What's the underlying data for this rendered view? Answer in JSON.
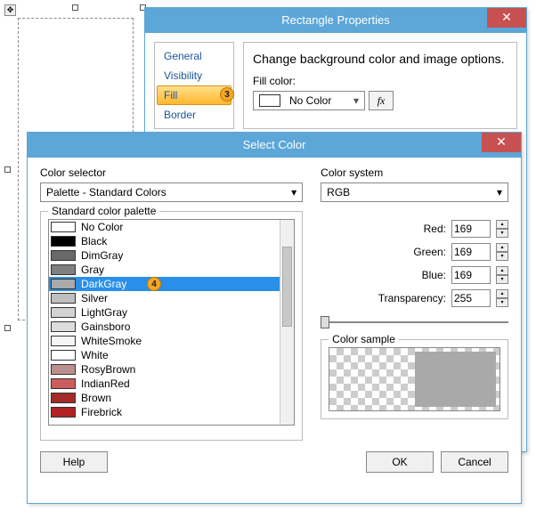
{
  "rect_dialog": {
    "title": "Rectangle Properties",
    "nav": [
      "General",
      "Visibility",
      "Fill",
      "Border"
    ],
    "nav_selected_index": 2,
    "description": "Change background color and image options.",
    "fill_color_label": "Fill color:",
    "fill_color_selected": "No Color",
    "fx_label": "fx",
    "badge_3": "3"
  },
  "select_dialog": {
    "title": "Select Color",
    "selector_label": "Color selector",
    "selector_value": "Palette - Standard Colors",
    "system_label": "Color system",
    "system_value": "RGB",
    "palette_legend": "Standard color palette",
    "colors": [
      {
        "name": "No Color",
        "hex": "#ffffff"
      },
      {
        "name": "Black",
        "hex": "#000000"
      },
      {
        "name": "DimGray",
        "hex": "#696969"
      },
      {
        "name": "Gray",
        "hex": "#808080"
      },
      {
        "name": "DarkGray",
        "hex": "#a9a9a9"
      },
      {
        "name": "Silver",
        "hex": "#c0c0c0"
      },
      {
        "name": "LightGray",
        "hex": "#d3d3d3"
      },
      {
        "name": "Gainsboro",
        "hex": "#dcdcdc"
      },
      {
        "name": "WhiteSmoke",
        "hex": "#f5f5f5"
      },
      {
        "name": "White",
        "hex": "#ffffff"
      },
      {
        "name": "RosyBrown",
        "hex": "#bc8f8f"
      },
      {
        "name": "IndianRed",
        "hex": "#cd5c5c"
      },
      {
        "name": "Brown",
        "hex": "#a52a2a"
      },
      {
        "name": "Firebrick",
        "hex": "#b22222"
      }
    ],
    "selected_color_index": 4,
    "badge_4": "4",
    "rgb_labels": {
      "r": "Red:",
      "g": "Green:",
      "b": "Blue:",
      "t": "Transparency:"
    },
    "rgb": {
      "r": "169",
      "g": "169",
      "b": "169",
      "t": "255"
    },
    "sample_legend": "Color sample",
    "help": "Help",
    "ok": "OK",
    "cancel": "Cancel"
  }
}
